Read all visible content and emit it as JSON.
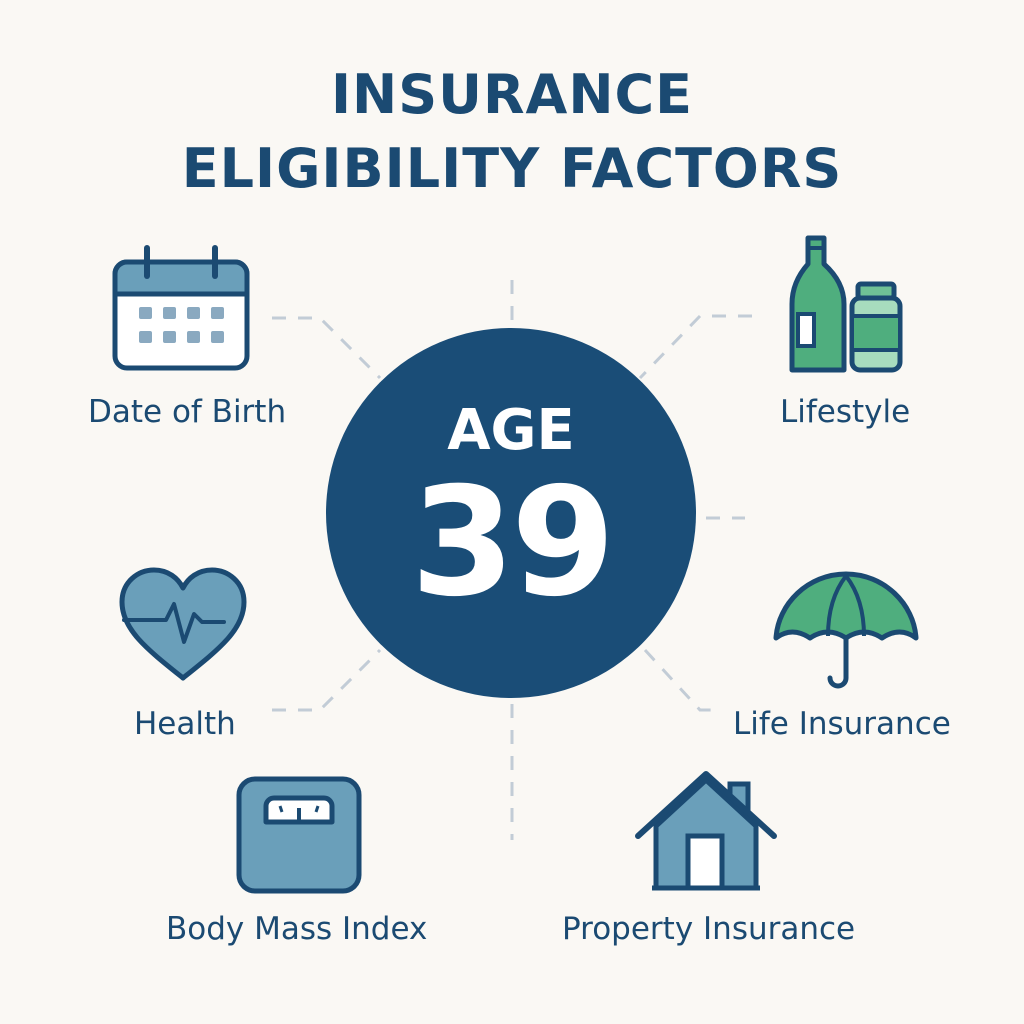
{
  "title": {
    "line1": "INSURANCE",
    "line2": "ELIGIBILITY FACTORS"
  },
  "center": {
    "label": "AGE",
    "value": "39"
  },
  "factors": [
    {
      "label": "Date of Birth",
      "icon": "calendar-icon"
    },
    {
      "label": "Lifestyle",
      "icon": "bottles-icon"
    },
    {
      "label": "Health",
      "icon": "heart-pulse-icon"
    },
    {
      "label": "Life Insurance",
      "icon": "umbrella-icon"
    },
    {
      "label": "Body Mass Index",
      "icon": "scale-icon"
    },
    {
      "label": "Property Insurance",
      "icon": "house-icon"
    }
  ],
  "colors": {
    "navy": "#1a4d77",
    "text": "#1b4a72",
    "steel_blue": "#6a9fba",
    "green": "#4fae7e",
    "light_green": "#a7dcbe",
    "connector": "#c2ccd6",
    "background": "#faf8f4"
  }
}
